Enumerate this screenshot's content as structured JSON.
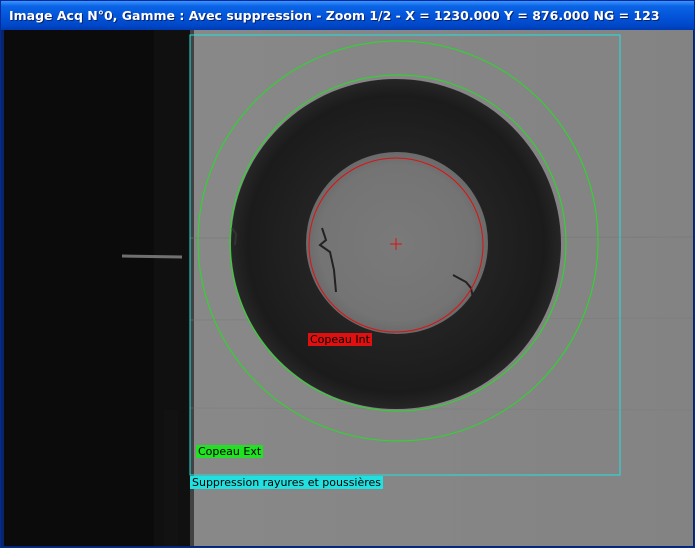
{
  "window": {
    "title": "Image Acq N°0, Gamme : Avec suppression  -  Zoom 1/2  - X = 1230.000   Y = 876.000   NG = 123"
  },
  "overlays": {
    "copeau_int": {
      "label": "Copeau Int",
      "color": "#e01010",
      "text_color": "#000000"
    },
    "copeau_ext": {
      "label": "Copeau Ext",
      "color": "#22e022",
      "text_color": "#000000"
    },
    "suppression": {
      "label": "Suppression rayures et poussières",
      "color": "#22e0e0",
      "text_color": "#000000"
    }
  },
  "colors": {
    "ring_outer_circle": "#22e022",
    "ring_inner_circle": "#22e022",
    "hole_circle": "#e01010",
    "roi_rectangle": "#22e0e0",
    "center_marker": "#e01010"
  },
  "icons": {
    "center_marker": "crosshair-icon"
  }
}
